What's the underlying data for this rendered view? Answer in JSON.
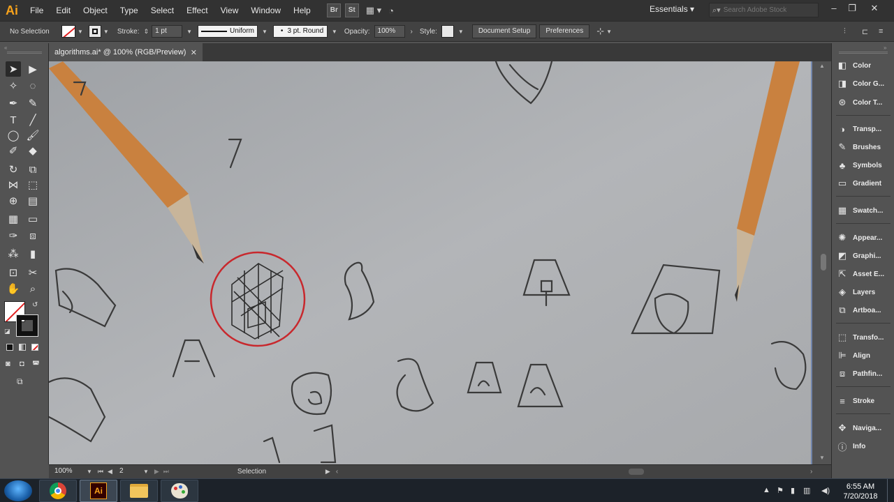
{
  "app": {
    "logo": "Ai"
  },
  "menu": [
    "File",
    "Edit",
    "Object",
    "Type",
    "Select",
    "Effect",
    "View",
    "Window",
    "Help"
  ],
  "menu_icons": {
    "bridge": "Br",
    "stock": "St"
  },
  "workspace": "Essentials",
  "stock_search": {
    "placeholder": "Search Adobe Stock"
  },
  "control": {
    "selection": "No Selection",
    "stroke_label": "Stroke:",
    "stroke_value": "1 pt",
    "profile": "Uniform",
    "brush": "3 pt. Round",
    "opacity_label": "Opacity:",
    "opacity_value": "100%",
    "style_label": "Style:",
    "doc_setup": "Document Setup",
    "preferences": "Preferences"
  },
  "document": {
    "tab_title": "algorithms.ai* @ 100% (RGB/Preview)"
  },
  "status": {
    "zoom": "100%",
    "artboard": "2",
    "tool": "Selection"
  },
  "panels": [
    {
      "label": "Color",
      "icon": "color-icon"
    },
    {
      "label": "Color G...",
      "icon": "color-guide-icon"
    },
    {
      "label": "Color T...",
      "icon": "color-themes-icon"
    },
    {
      "label": "Transp...",
      "icon": "transparency-icon"
    },
    {
      "label": "Brushes",
      "icon": "brushes-icon"
    },
    {
      "label": "Symbols",
      "icon": "symbols-icon"
    },
    {
      "label": "Gradient",
      "icon": "gradient-icon"
    },
    {
      "label": "Swatch...",
      "icon": "swatches-icon"
    },
    {
      "label": "Appear...",
      "icon": "appearance-icon"
    },
    {
      "label": "Graphi...",
      "icon": "graphic-styles-icon"
    },
    {
      "label": "Asset E...",
      "icon": "asset-export-icon"
    },
    {
      "label": "Layers",
      "icon": "layers-icon"
    },
    {
      "label": "Artboa...",
      "icon": "artboards-icon"
    },
    {
      "label": "Transfo...",
      "icon": "transform-icon"
    },
    {
      "label": "Align",
      "icon": "align-icon"
    },
    {
      "label": "Pathfin...",
      "icon": "pathfinder-icon"
    },
    {
      "label": "Stroke",
      "icon": "stroke-icon"
    },
    {
      "label": "Naviga...",
      "icon": "navigator-icon"
    },
    {
      "label": "Info",
      "icon": "info-icon"
    }
  ],
  "taskbar": {
    "time": "6:55 AM",
    "date": "7/20/2018",
    "apps": [
      "chrome",
      "illustrator",
      "file-explorer",
      "paint"
    ]
  },
  "colors": {
    "accent": "#f7a21b",
    "annotation_circle": "#c8282d",
    "canvas": "#a8aaad"
  }
}
